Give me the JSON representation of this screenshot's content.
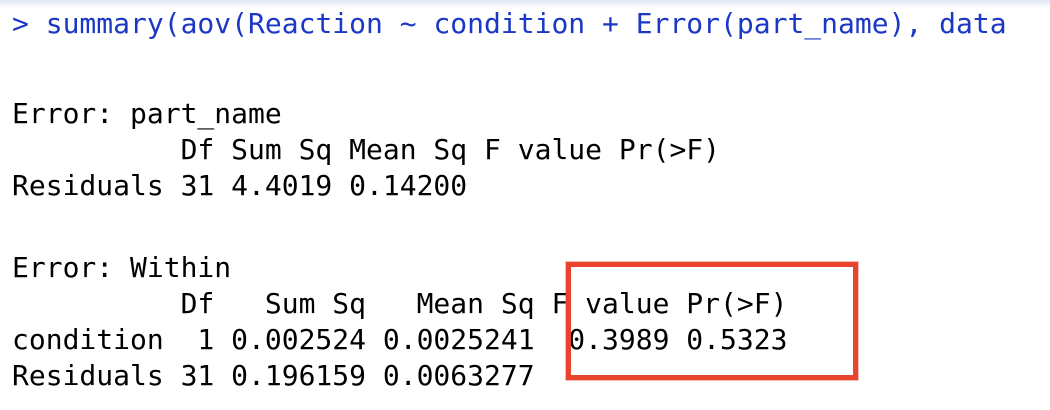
{
  "console": {
    "command": {
      "prompt": ">",
      "text": "summary(aov(Reaction ~ condition + Error(part_name), data"
    },
    "stratum1": {
      "title": "Error: part_name",
      "header": "          Df Sum Sq Mean Sq F value Pr(>F)",
      "rows": [
        "Residuals 31 4.4019 0.14200"
      ]
    },
    "stratum2": {
      "title": "Error: Within",
      "header": "          Df   Sum Sq   Mean Sq F value Pr(>F)",
      "rows": [
        "condition  1 0.002524 0.0025241  0.3989 0.5323",
        "Residuals 31 0.196159 0.0063277"
      ]
    }
  },
  "annotation": {
    "box_color": "#e8432c",
    "target": "F value / Pr(>F) columns"
  },
  "colors": {
    "command": "#1a37c6",
    "output": "#000000"
  }
}
